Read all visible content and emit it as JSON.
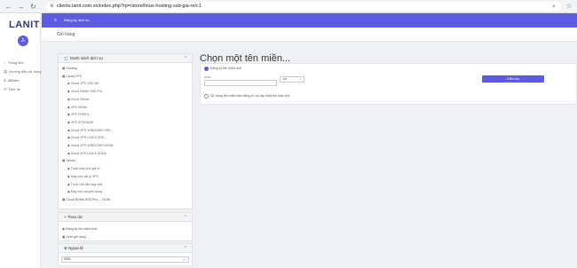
{
  "browser": {
    "url": "clients.lanit.com.vn/index.php?rp=/store/linux-hosting-ssd-gia-re/c1"
  },
  "sidebar": {
    "logo": "LANIT",
    "items": [
      {
        "label": "Trang chủ"
      },
      {
        "label": "Hướng dẫn sử dụng"
      },
      {
        "label": "Affiliate"
      },
      {
        "label": "Liên hệ"
      }
    ]
  },
  "topbar": {
    "link": "Đăng ký dịch vụ"
  },
  "breadcrumb": "Giỏ hàng",
  "categories": {
    "header": "Danh sách dịch vụ",
    "items": [
      {
        "label": "Hosting",
        "child": false
      },
      {
        "label": "Cloud VPS",
        "child": false
      },
      {
        "label": "Cloud VPS SSD NE",
        "child": true
      },
      {
        "label": "Cloud NVMe SSD Pro",
        "child": true
      },
      {
        "label": "Cloud Server",
        "child": true
      },
      {
        "label": "VPS NVMe",
        "child": true
      },
      {
        "label": "VPS FOREX",
        "child": true
      },
      {
        "label": "VPS STORAGE",
        "child": true
      },
      {
        "label": "Cloud VPS WINDOWS SSD",
        "child": true
      },
      {
        "label": "Cloud VPS LINUX SSD",
        "child": true
      },
      {
        "label": "Cloud VPS WINDOWS NVMe",
        "child": true
      },
      {
        "label": "Cloud VPS LINUX NVMe",
        "child": true
      },
      {
        "label": "Server",
        "child": false
      },
      {
        "label": "Thuê máy chủ giá rẻ",
        "child": true
      },
      {
        "label": "Máy chủ vật lý VPS",
        "child": true
      },
      {
        "label": "Thuê chỗ đặt máy chủ",
        "child": true
      },
      {
        "label": "Máy chủ chuyên dụng",
        "child": true
      },
      {
        "label": "Cloud NVMe SSD Pro — ROM",
        "child": false
      }
    ]
  },
  "actions": {
    "header": "Thao tác",
    "items": [
      {
        "label": "Đăng ký tên miền mới"
      },
      {
        "label": "Xem giỏ hàng"
      }
    ]
  },
  "currency": {
    "header": "Ngoại tệ",
    "selected": "VND"
  },
  "main": {
    "title": "Chọn một tên miền...",
    "option_register": "Đăng ký tên miền mới",
    "field_label": "www.",
    "domain_placeholder": "",
    "tld_selected": ".vn",
    "check_button": "Kiểm tra",
    "option_own": "Sử dụng tên miền bạn đang có và cập nhật tên máy chủ"
  },
  "colors": {
    "accent": "#5b5ce2",
    "background": "#eef0f4"
  }
}
